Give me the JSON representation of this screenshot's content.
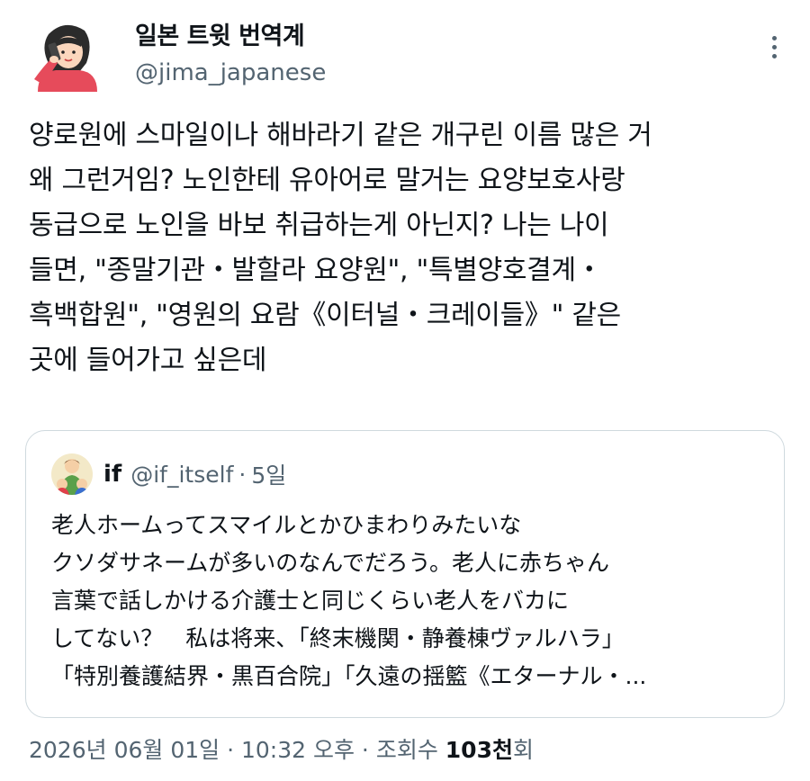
{
  "author": {
    "display_name": "일본 트윗 번역계",
    "handle": "@jima_japanese"
  },
  "tweet": {
    "lines": [
      "양로원에 스마일이나 해바라기 같은 개구린 이름 많은 거",
      "왜 그런거임? 노인한테 유아어로 말거는 요양보호사랑",
      "동급으로 노인을 바보 취급하는게 아닌지? 나는 나이",
      "들면, \"종말기관・발할라 요양원\", \"특별양호결계・",
      "흑백합원\", \"영원의 요람《이터널・크레이들》\" 같은",
      "곳에 들어가고 싶은데"
    ]
  },
  "quote": {
    "name": "if",
    "handle": "@if_itself",
    "dot": "·",
    "time": "5일",
    "lines": [
      "老人ホームってスマイルとかひまわりみたいな",
      "クソダサネームが多いのなんでだろう。老人に赤ちゃん",
      "言葉で話しかける介護士と同じくらい老人をバカに",
      "してない？　私は将来、「終末機関・静養棟ヴァルハラ」",
      "「特別養護結界・黒百合院」「久遠の揺籃《エターナル・..."
    ]
  },
  "meta": {
    "date": "2026년 06월 01일",
    "sep1": " · ",
    "time": "10:32 오후",
    "sep2": " · ",
    "views_label": "조회수 ",
    "views_count": "103천",
    "views_suffix": "회"
  },
  "icons": {
    "author_avatar": "woman-on-phone-avatar",
    "more": "more-vertical-icon",
    "quote_avatar": "family-avatar"
  }
}
